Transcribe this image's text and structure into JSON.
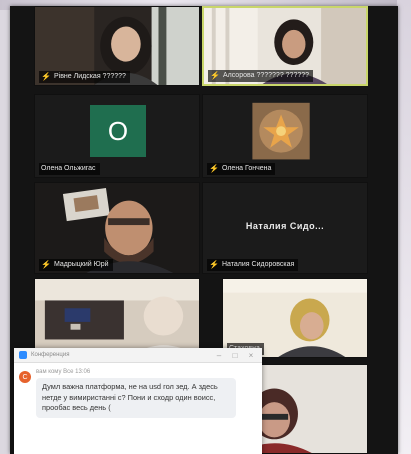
{
  "colors": {
    "screen_bg": "#141414",
    "tile_bg": "#1b1b1b",
    "active_border": "#c9d66a",
    "mic_muted": "#e0453c",
    "avatar_bg": "#1f6e4f",
    "chat_avatar": "#e6622c"
  },
  "participants": [
    {
      "name": "Рівне Лидская ??????",
      "muted": true,
      "video": true
    },
    {
      "name": "Алсорова ??????? ??????",
      "muted": true,
      "video": true
    },
    {
      "name": "Олена Ольжигас",
      "muted": false,
      "video": false,
      "avatar_letter": "O"
    },
    {
      "name": "Олена Гончена",
      "muted": true,
      "video": true
    },
    {
      "name": "Мадрыцкий Юрй",
      "muted": true,
      "video": true
    },
    {
      "name": "Наталия Сидоровская",
      "muted": true,
      "video": false,
      "display_name": "Наталия Сидо..."
    },
    {
      "name": "",
      "muted": false,
      "video": true
    },
    {
      "name": "Стаховна",
      "muted": false,
      "video": true
    },
    {
      "name": "",
      "muted": false,
      "video": true
    }
  ],
  "icons": {
    "mic": "mic-muted-icon",
    "chat_app": "zoom-chat-logo-icon",
    "minimize": "minimize-icon",
    "maximize": "maximize-icon",
    "close": "close-icon"
  },
  "chat": {
    "app_name": "Конференция",
    "minimize_glyph": "–",
    "maximize_glyph": "□",
    "close_glyph": "×",
    "avatar_letter": "С",
    "meta": "вам кому Все 13:06",
    "message": "Думл важна платформа, не на usd гол зед. А здесь нетде у вимиристанні с? Пони и сходр один воисс, прообас весь день ("
  }
}
